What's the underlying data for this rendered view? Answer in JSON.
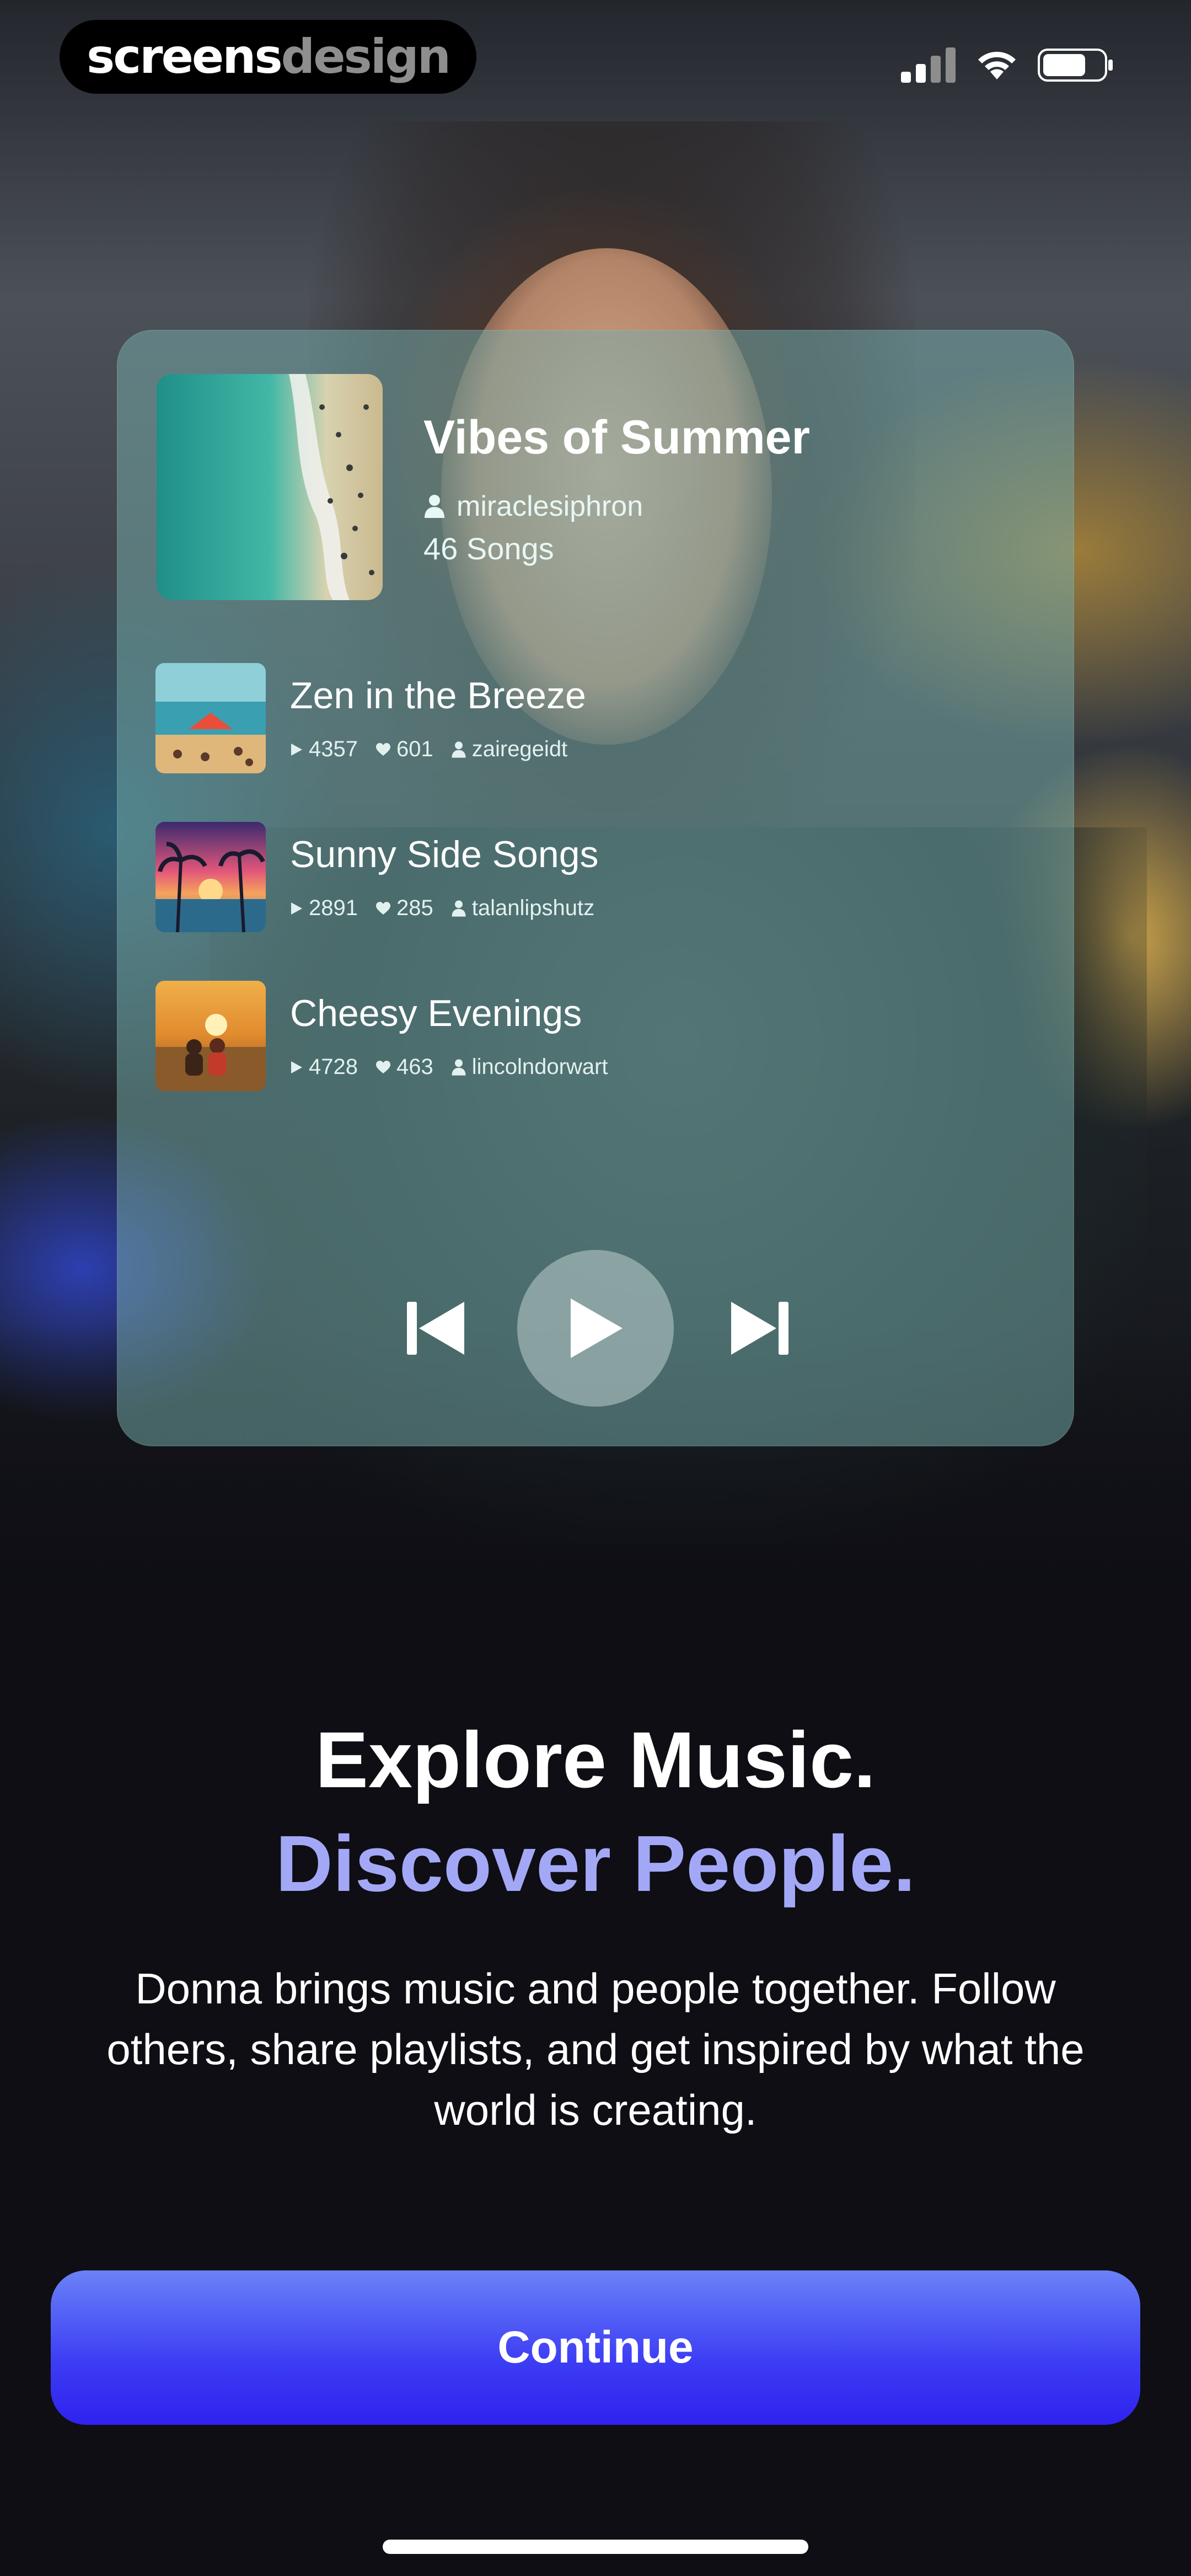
{
  "status_bar": {
    "brand_part1": "screens",
    "brand_part2": "design"
  },
  "player": {
    "playlist_title": "Vibes of Summer",
    "owner": "miraclesiphron",
    "song_count": "46 Songs",
    "tracks": [
      {
        "title": "Zen in the Breeze",
        "plays": "4357",
        "likes": "601",
        "user": "zairegeidt"
      },
      {
        "title": "Sunny Side Songs",
        "plays": "2891",
        "likes": "285",
        "user": "talanlipshutz"
      },
      {
        "title": "Cheesy Evenings",
        "plays": "4728",
        "likes": "463",
        "user": "lincolndorwart"
      }
    ],
    "icons": {
      "prev": "skip-previous-icon",
      "play": "play-icon",
      "next": "skip-next-icon",
      "user": "user-icon",
      "plays": "play-count-icon",
      "likes": "heart-icon"
    }
  },
  "onboarding": {
    "headline_1": "Explore Music.",
    "headline_2": "Discover People.",
    "body": "Donna brings music and people together. Follow others, share playlists, and get inspired by what the world is creating.",
    "continue_label": "Continue"
  },
  "colors": {
    "accent": "#3c3cf4",
    "headline_accent": "#a3a8f6",
    "background": "#0e0e14"
  }
}
